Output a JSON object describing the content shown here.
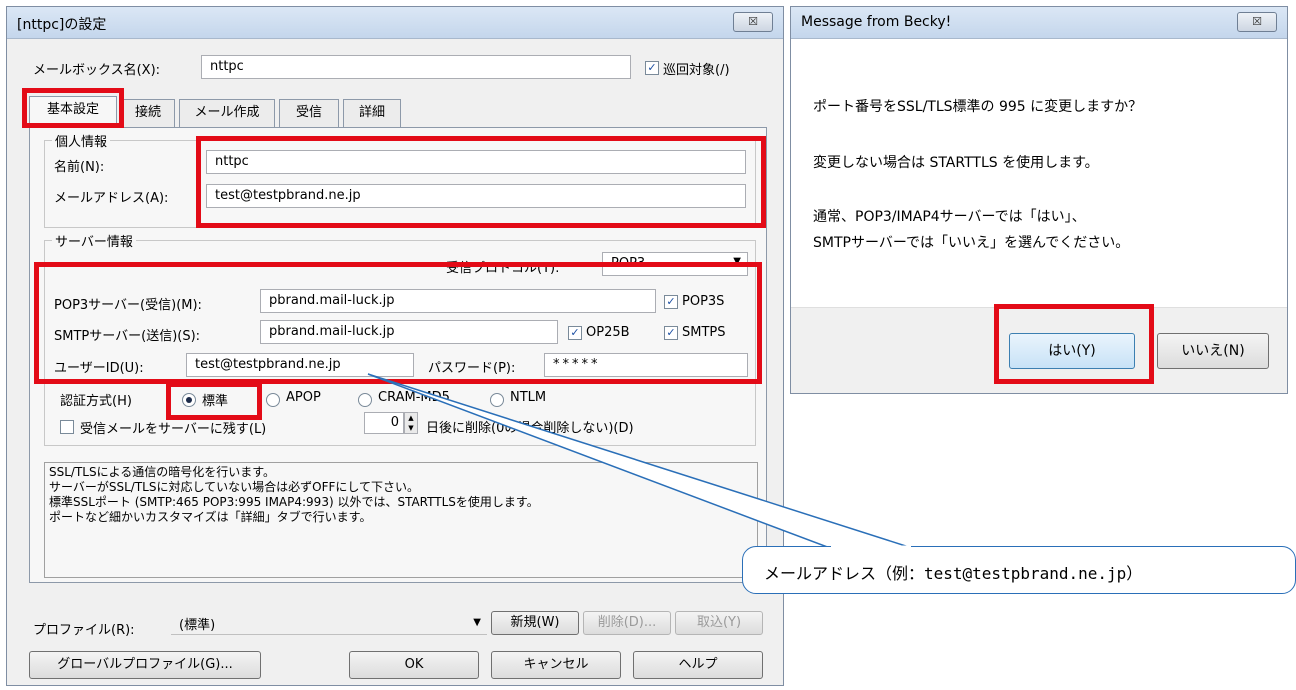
{
  "settings": {
    "title": "[nttpc]の設定",
    "close_glyph": "☒",
    "mailbox_label": "メールボックス名(X):",
    "mailbox_value": "nttpc",
    "patrol_label": "巡回対象(/)",
    "tabs": [
      "基本設定",
      "接続",
      "メール作成",
      "受信",
      "詳細"
    ],
    "personal": {
      "group_label": "個人情報",
      "name_label": "名前(N):",
      "name_value": "nttpc",
      "email_label": "メールアドレス(A):",
      "email_value": "test@testpbrand.ne.jp"
    },
    "server": {
      "group_label": "サーバー情報",
      "protocol_label": "受信プロトコル(T):",
      "protocol_value": "POP3",
      "pop3_label": "POP3サーバー(受信)(M):",
      "pop3_value": "pbrand.mail-luck.jp",
      "pop3s_label": "POP3S",
      "smtp_label": "SMTPサーバー(送信)(S):",
      "smtp_value": "pbrand.mail-luck.jp",
      "op25b_label": "OP25B",
      "smtps_label": "SMTPS",
      "userid_label": "ユーザーID(U):",
      "userid_value": "test@testpbrand.ne.jp",
      "password_label": "パスワード(P):",
      "password_value": "*****",
      "auth_label": "認証方式(H)",
      "auth_options": [
        "標準",
        "APOP",
        "CRAM-MD5",
        "NTLM"
      ],
      "leave_label": "受信メールをサーバーに残す(L)",
      "days_value": "0",
      "days_suffix": "日後に削除(0の場合削除しない)(D)"
    },
    "help_lines": [
      "SSL/TLSによる通信の暗号化を行います。",
      "サーバーがSSL/TLSに対応していない場合は必ずOFFにして下さい。",
      "標準SSLポート (SMTP:465 POP3:995 IMAP4:993) 以外では、STARTTLSを使用します。",
      "ポートなど細かいカスタマイズは「詳細」タブで行います。"
    ],
    "profile_label": "プロファイル(R):",
    "profile_value": "(標準)",
    "new_button": "新規(W)",
    "delete_button": "削除(D)...",
    "import_button": "取込(Y)",
    "global_profile_button": "グローバルプロファイル(G)...",
    "ok_button": "OK",
    "cancel_button": "キャンセル",
    "help_button": "ヘルプ"
  },
  "message_box": {
    "title": "Message from Becky!",
    "close_glyph": "☒",
    "line1": "ポート番号をSSL/TLS標準の 995 に変更しますか？",
    "line2": "変更しない場合は STARTTLS を使用します。",
    "line3": "通常、POP3/IMAP4サーバーでは「はい」、",
    "line4": "SMTPサーバーでは「いいえ」を選んでください。",
    "yes_button": "はい(Y)",
    "no_button": "いいえ(N)"
  },
  "callout": {
    "text": "メールアドレス（例：test@testpbrand.ne.jp）"
  },
  "colors": {
    "highlight_red": "#e30b17",
    "callout_blue": "#2a6fb8"
  }
}
